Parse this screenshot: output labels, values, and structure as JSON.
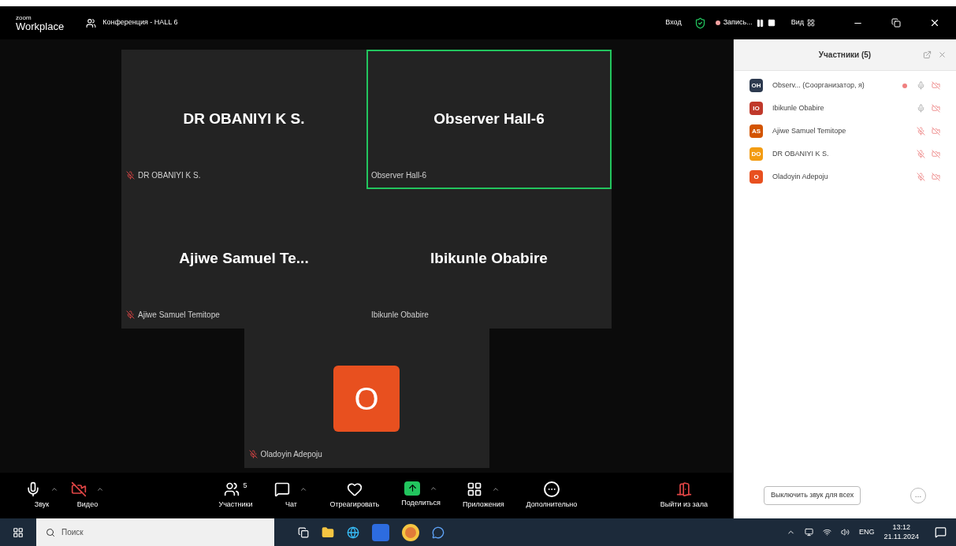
{
  "window": {
    "app_name": "zoom",
    "app_subtitle": "Workplace",
    "title": "Конференция - HALL 6",
    "signin": "Вход",
    "recording": "Запись...",
    "view": "Вид"
  },
  "tiles": [
    {
      "kind": "name",
      "display": "DR  OBANIYI K  S.",
      "label": "DR  OBANIYI K  S.",
      "muted": true,
      "speaking": false
    },
    {
      "kind": "name",
      "display": "Observer Hall-6",
      "label": "Observer Hall-6",
      "muted": false,
      "speaking": true
    },
    {
      "kind": "name",
      "display": "Ajiwe Samuel Te...",
      "label": "Ajiwe Samuel Temitope",
      "muted": true,
      "speaking": false
    },
    {
      "kind": "name",
      "display": "Ibikunle Obabire",
      "label": "Ibikunle Obabire",
      "muted": false,
      "speaking": false
    },
    {
      "kind": "avatar",
      "display": "O",
      "label": "Oladoyin Adepoju",
      "muted": true,
      "speaking": false
    }
  ],
  "toolbar": [
    {
      "kind": "mic",
      "label": "Звук",
      "caret": true
    },
    {
      "kind": "video",
      "label": "Видео",
      "caret": true
    },
    {
      "kind": "participants",
      "label": "Участники",
      "count": "5",
      "caret": false
    },
    {
      "kind": "chat",
      "label": "Чат",
      "caret": true
    },
    {
      "kind": "react",
      "label": "Отреагировать",
      "caret": false
    },
    {
      "kind": "share",
      "label": "Поделиться",
      "caret": true
    },
    {
      "kind": "apps",
      "label": "Приложения",
      "caret": true
    },
    {
      "kind": "more",
      "label": "Дополнительно",
      "caret": false
    },
    {
      "kind": "leave",
      "label": "Выйти из зала",
      "caret": false
    }
  ],
  "panel": {
    "title": "Участники (5)",
    "participants": [
      {
        "initials": "OH",
        "color": "#2d3a4f",
        "name": "Observ...  (Соорганизатор, я)",
        "recording": true,
        "muted": false
      },
      {
        "initials": "IO",
        "color": "#c0392b",
        "name": "Ibikunle Obabire",
        "recording": false,
        "muted": false
      },
      {
        "initials": "AS",
        "color": "#d35400",
        "name": "Ajiwe Samuel Temitope",
        "recording": false,
        "muted": true
      },
      {
        "initials": "DO",
        "color": "#f39c12",
        "name": "DR  OBANIYI K  S.",
        "recording": false,
        "muted": true
      },
      {
        "initials": "O",
        "color": "#e8501f",
        "name": "Oladoyin Adepoju",
        "recording": false,
        "muted": true
      }
    ],
    "mute_all": "Выключить звук для всех",
    "more": "…"
  },
  "taskbar": {
    "search_placeholder": "Поиск",
    "language": "ENG",
    "time": "13:12",
    "date": "21.11.2024"
  }
}
